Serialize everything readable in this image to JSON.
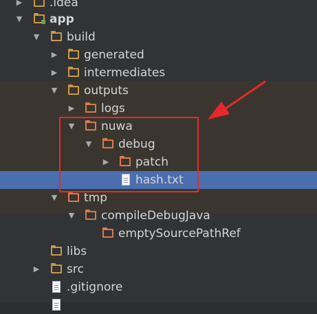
{
  "tree": {
    "items": [
      {
        "id": "idea",
        "label": ".idea",
        "icon": "folder-icon"
      },
      {
        "id": "app",
        "label": "app",
        "icon": "module-folder-icon",
        "expanded": true
      },
      {
        "id": "build",
        "label": "build",
        "icon": "folder-icon",
        "expanded": true
      },
      {
        "id": "generated",
        "label": "generated",
        "icon": "folder-icon",
        "expanded": false
      },
      {
        "id": "intermediates",
        "label": "intermediates",
        "icon": "folder-icon",
        "expanded": false
      },
      {
        "id": "outputs",
        "label": "outputs",
        "icon": "folder-icon",
        "expanded": true
      },
      {
        "id": "logs",
        "label": "logs",
        "icon": "excluded-folder-icon",
        "expanded": false
      },
      {
        "id": "nuwa",
        "label": "nuwa",
        "icon": "excluded-folder-icon",
        "expanded": true
      },
      {
        "id": "debug",
        "label": "debug",
        "icon": "excluded-folder-icon",
        "expanded": true
      },
      {
        "id": "patch",
        "label": "patch",
        "icon": "excluded-folder-icon",
        "expanded": false
      },
      {
        "id": "hash",
        "label": "hash.txt",
        "icon": "text-file-icon",
        "selected": true
      },
      {
        "id": "tmp",
        "label": "tmp",
        "icon": "excluded-folder-icon",
        "expanded": true
      },
      {
        "id": "compiledebugjava",
        "label": "compileDebugJava",
        "icon": "excluded-folder-icon",
        "expanded": true
      },
      {
        "id": "emptysourcepathref",
        "label": "emptySourcePathRef",
        "icon": "excluded-folder-icon"
      },
      {
        "id": "libs",
        "label": "libs",
        "icon": "folder-icon"
      },
      {
        "id": "src",
        "label": "src",
        "icon": "folder-icon",
        "expanded": false
      },
      {
        "id": "gitignore",
        "label": ".gitignore",
        "icon": "text-file-icon"
      }
    ]
  },
  "colors": {
    "background": "#2b2d30",
    "selection": "#4b6eaf",
    "folder": "#c79a45",
    "excluded_folder": "#d97a4f",
    "annotation": "#e8282d"
  }
}
